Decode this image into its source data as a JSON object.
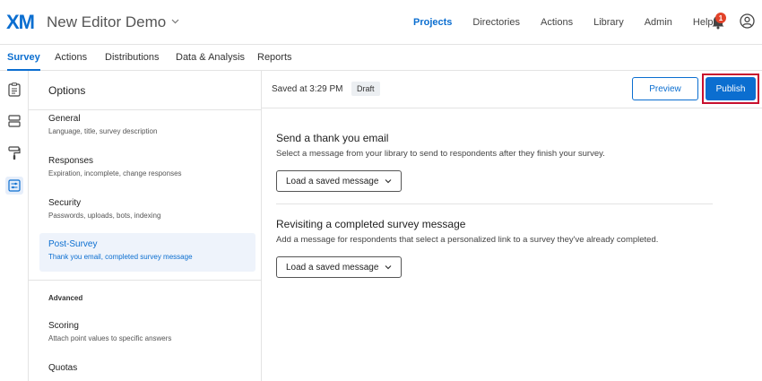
{
  "header": {
    "logo": "XM",
    "project_title": "New Editor Demo",
    "nav": [
      "Projects",
      "Directories",
      "Actions",
      "Library",
      "Admin",
      "Help"
    ],
    "notification_count": "1"
  },
  "tabs": [
    "Survey",
    "Actions",
    "Distributions",
    "Data & Analysis",
    "Reports"
  ],
  "rail_icons": [
    "survey-icon",
    "blocks-icon",
    "paint-roller-icon",
    "options-icon"
  ],
  "options": {
    "title": "Options",
    "items": [
      {
        "title": "General",
        "desc": "Language, title, survey description"
      },
      {
        "title": "Responses",
        "desc": "Expiration, incomplete, change responses"
      },
      {
        "title": "Security",
        "desc": "Passwords, uploads, bots, indexing"
      },
      {
        "title": "Post-Survey",
        "desc": "Thank you email, completed survey message"
      }
    ],
    "advanced_label": "Advanced",
    "advanced_items": [
      {
        "title": "Scoring",
        "desc": "Attach point values to specific answers"
      },
      {
        "title": "Quotas",
        "desc": ""
      }
    ]
  },
  "status": {
    "saved": "Saved at 3:29 PM",
    "draft": "Draft",
    "preview_label": "Preview",
    "publish_label": "Publish"
  },
  "sections": [
    {
      "title": "Send a thank you email",
      "desc": "Select a message from your library to send to respondents after they finish your survey.",
      "button": "Load a saved message"
    },
    {
      "title": "Revisiting a completed survey message",
      "desc": "Add a message for respondents that select a personalized link to a survey they've already completed.",
      "button": "Load a saved message"
    }
  ],
  "colors": {
    "accent": "#0b6ed0",
    "highlight": "#c8102e",
    "badge": "#e2432a"
  }
}
